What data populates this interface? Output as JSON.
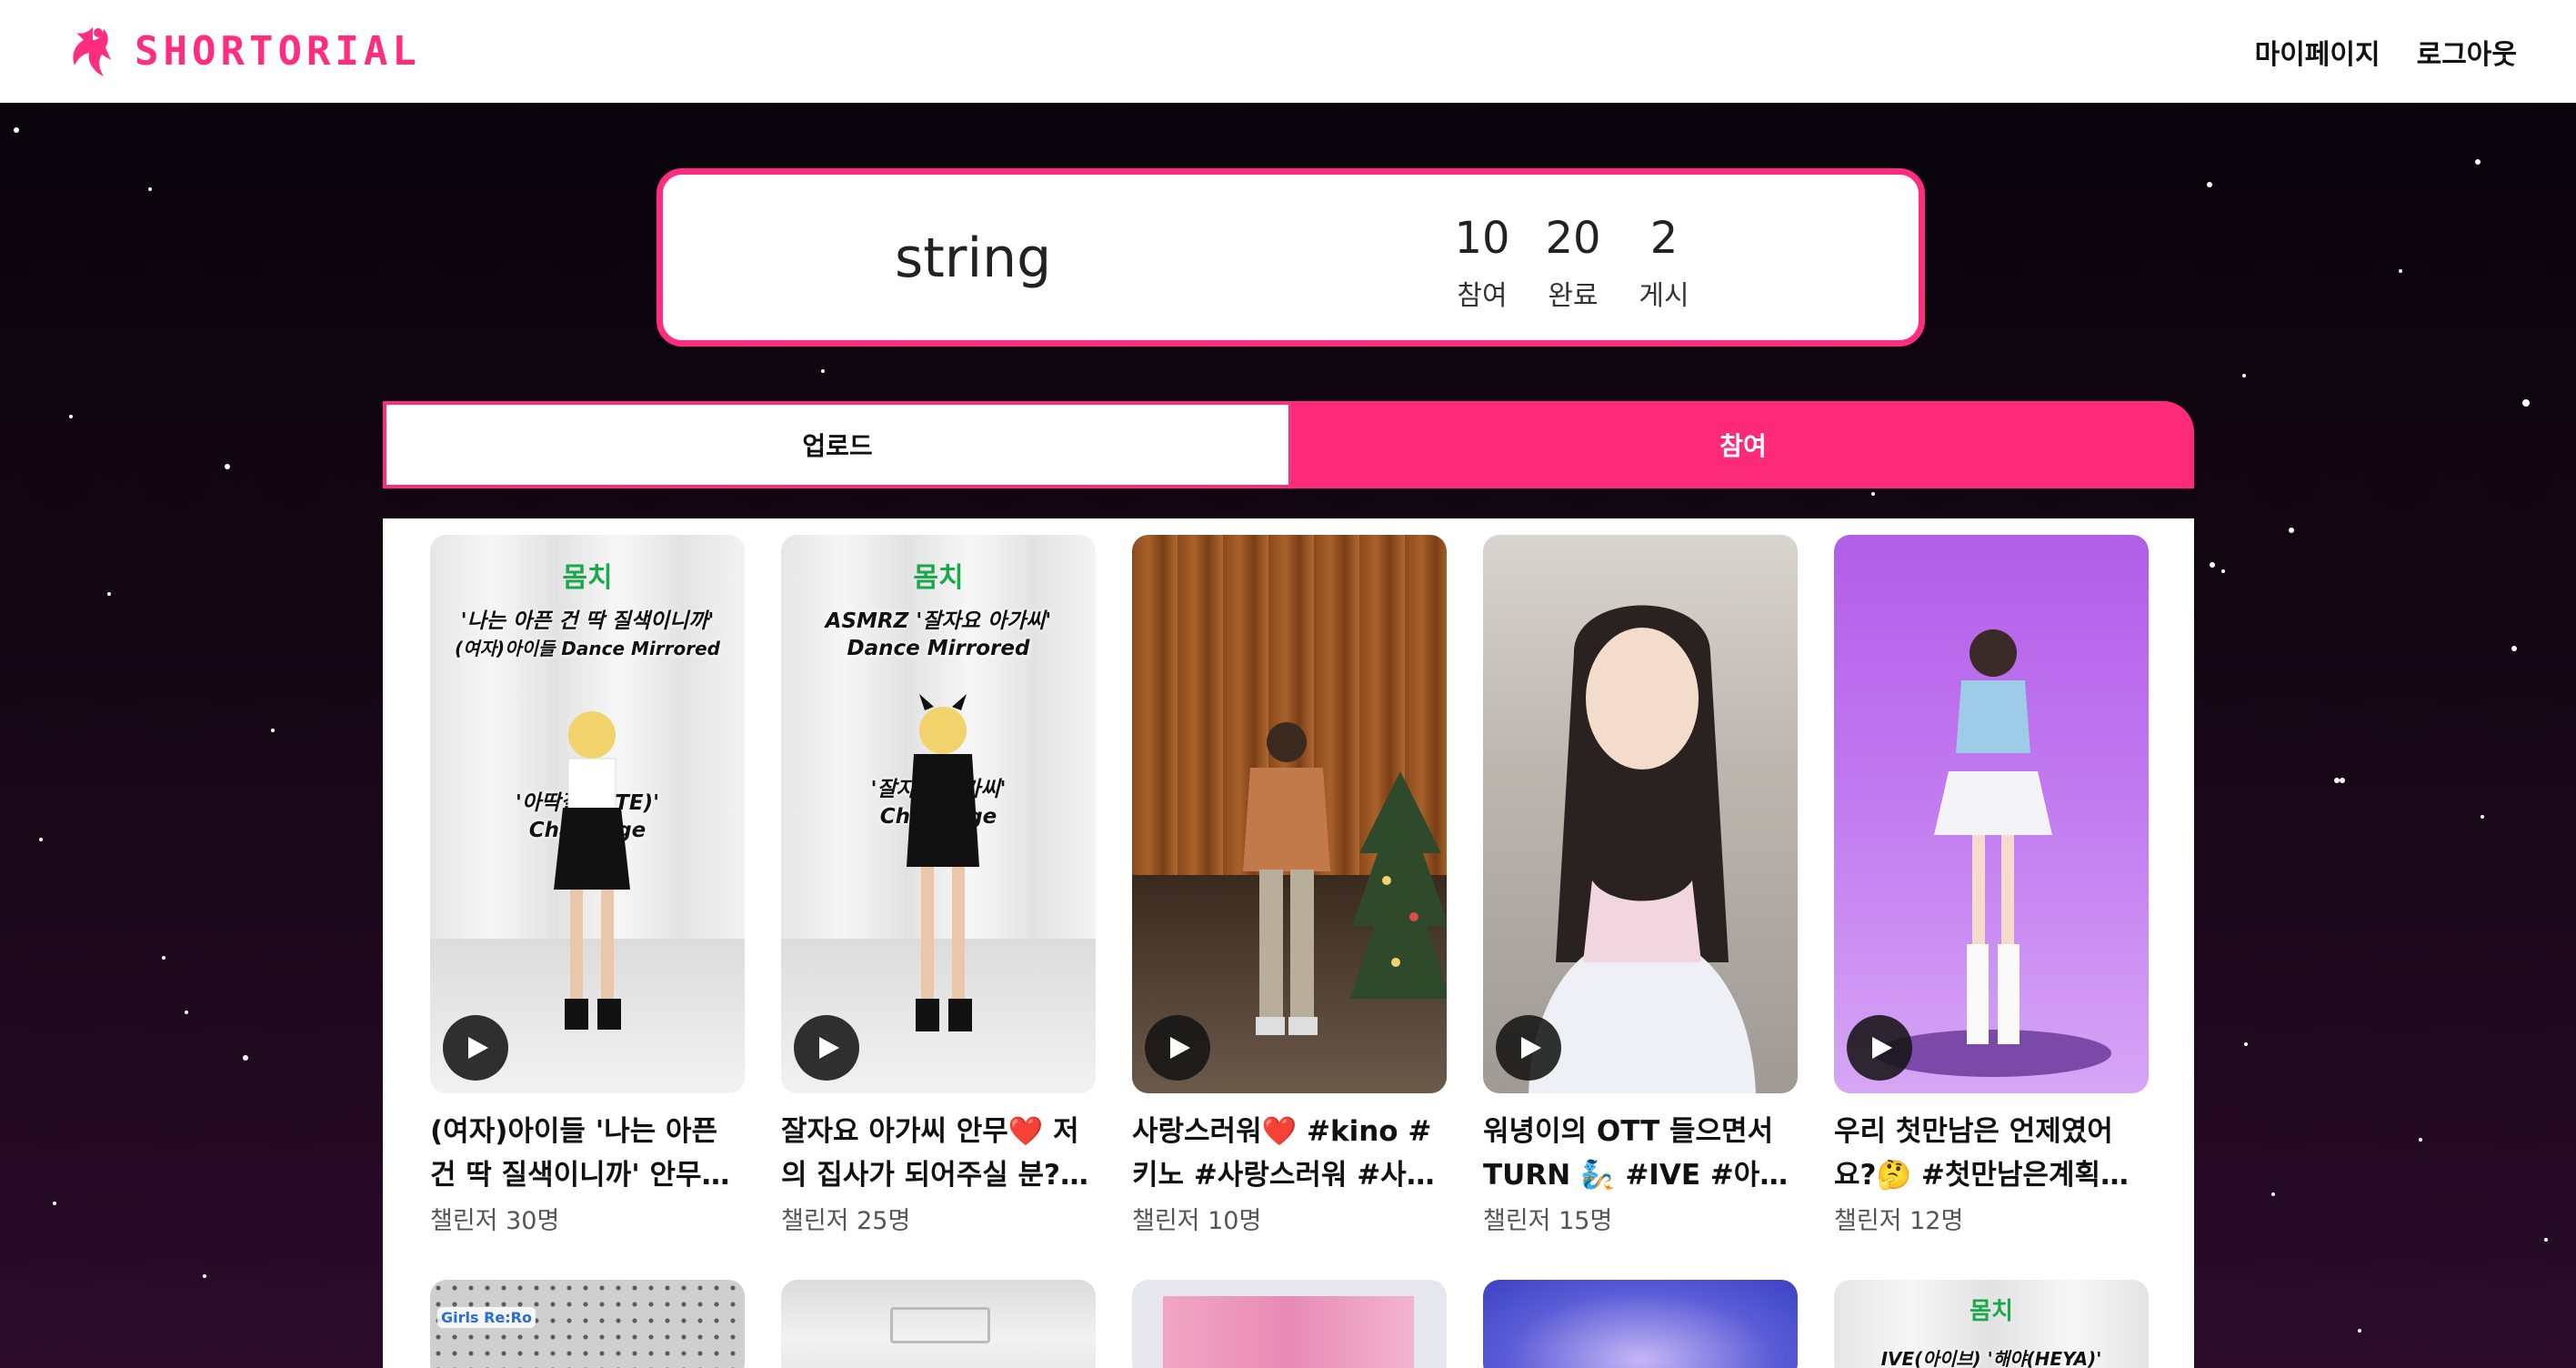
{
  "header": {
    "brand": "SHORTORIAL",
    "nav": [
      "마이페이지",
      "로그아웃"
    ]
  },
  "profile": {
    "name": "string",
    "stats": [
      {
        "value": "10",
        "label": "참여"
      },
      {
        "value": "20",
        "label": "완료"
      },
      {
        "value": "2",
        "label": "게시"
      }
    ]
  },
  "tabs": {
    "upload": "업로드",
    "join": "참여",
    "active": "join"
  },
  "cards": [
    {
      "title": "(여자)아이들 '나는 아픈 건 딱 질색이니까' 안무…",
      "meta": "챌린저 30명",
      "watermark": "몸치",
      "overlay_top": [
        "'나는 아픈 건 딱 질색이니까'",
        "(여자)아이들 Dance Mirrored"
      ],
      "overlay_mid": [
        "'아딱질(FATE)'",
        "Challenge"
      ]
    },
    {
      "title": "잘자요 아가씨 안무❤️ 저의 집사가 되어주실 분?…",
      "meta": "챌린저 25명",
      "watermark": "몸치",
      "overlay_top": [
        "ASMRZ '잘자요 아가씨'",
        "Dance Mirrored"
      ],
      "overlay_mid": [
        "'잘자요 아가씨'",
        "Challenge"
      ]
    },
    {
      "title": "사랑스러워❤️ #kino #키노 #사랑스러워 #사랑…",
      "meta": "챌린저 10명"
    },
    {
      "title": "워녕이의 OTT 들으면서 TURN 🧞 #IVE #아이…",
      "meta": "챌린저 15명"
    },
    {
      "title": "우리 첫만남은 언제였어요?🤔 #첫만남은계획…",
      "meta": "챌린저 12명"
    }
  ],
  "second_row": [
    {
      "badge": "Girls Re:Ro"
    },
    {},
    {},
    {},
    {
      "watermark": "몸치",
      "overlay_top": [
        "IVE(아이브) '해야(HEYA)'"
      ]
    }
  ],
  "colors": {
    "accent": "#ff2d7f",
    "tab_active": "#fd2a7a",
    "background_top": "#07030a",
    "background_bottom": "#2a0c2a"
  },
  "icons": [
    "brand-logo-icon",
    "play-icon"
  ]
}
